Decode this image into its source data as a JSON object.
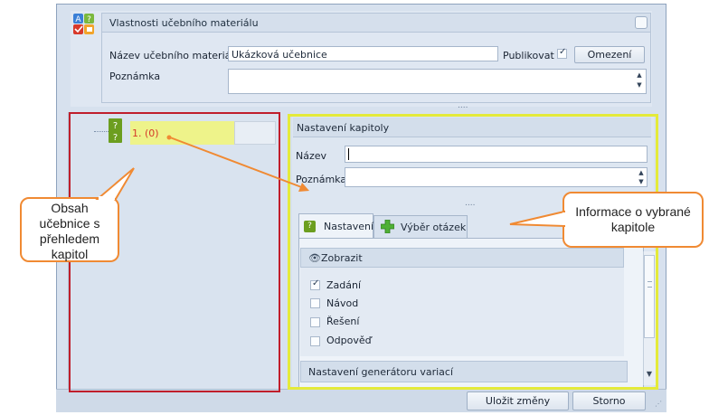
{
  "properties": {
    "title": "Vlastnosti učebního materiálu",
    "name_label": "Název učebního materiálu",
    "name_value": "Ukázková učebnice",
    "publish_label": "Publikovat",
    "publish_checked": true,
    "limits_button": "Omezení",
    "note_label": "Poznámka",
    "splitter": "...."
  },
  "tree": {
    "items": [
      {
        "label": "1. (0)"
      }
    ]
  },
  "chapter": {
    "title": "Nastavení kapitoly",
    "name_label": "Název",
    "note_label": "Poznámka",
    "splitter": "....",
    "tabs": [
      {
        "label": "Nastavení",
        "icon": "question-icon"
      },
      {
        "label": "Výběr otázek",
        "icon": "plus-icon"
      }
    ],
    "display_group": {
      "title": "Zobrazit",
      "icon": "eye-icon",
      "options": [
        {
          "label": "Zadání",
          "checked": true
        },
        {
          "label": "Návod",
          "checked": false
        },
        {
          "label": "Řešení",
          "checked": false
        },
        {
          "label": "Odpověď",
          "checked": false
        }
      ]
    },
    "generator_group": {
      "title": "Nastavení generátoru variací"
    }
  },
  "footer": {
    "save_button": "Uložit změny",
    "cancel_button": "Storno"
  },
  "annotations": {
    "left_callout": "Obsah učebnice s přehledem kapitol",
    "right_callout": "Informace o vybrané kapitole"
  },
  "colors": {
    "red_box": "#c01e2b",
    "yellow_box": "#e4ea3a",
    "callout_border": "#f08a33",
    "arrow": "#f08a33",
    "tree_item_text": "#d43a2a"
  }
}
